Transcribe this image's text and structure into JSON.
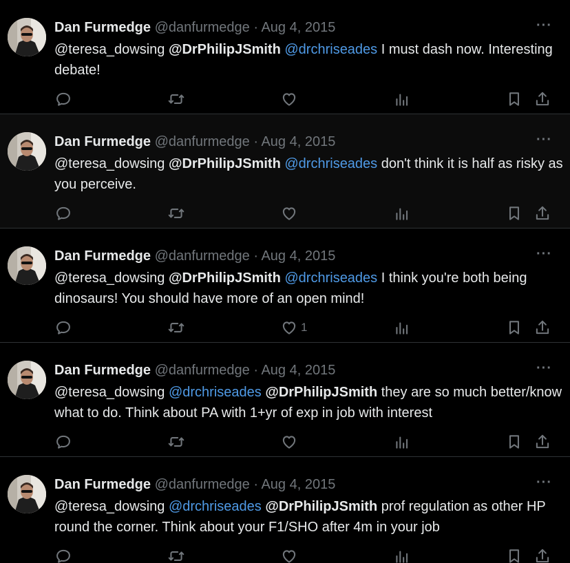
{
  "tweets": [
    {
      "name": "Dan Furmedge",
      "handle": "@danfurmedge",
      "date": "· Aug 4, 2015",
      "more": "···",
      "highlight": false,
      "body": [
        {
          "text": "@teresa_dowsing ",
          "style": "plain"
        },
        {
          "text": "@DrPhilipJSmith",
          "style": "bold"
        },
        {
          "text": " ",
          "style": "plain"
        },
        {
          "text": "@drchriseades",
          "style": "link"
        },
        {
          "text": " I must dash now. Interesting debate!",
          "style": "plain"
        }
      ],
      "likes": ""
    },
    {
      "name": "Dan Furmedge",
      "handle": "@danfurmedge",
      "date": "· Aug 4, 2015",
      "more": "···",
      "highlight": true,
      "body": [
        {
          "text": "@teresa_dowsing ",
          "style": "plain"
        },
        {
          "text": "@DrPhilipJSmith",
          "style": "bold"
        },
        {
          "text": " ",
          "style": "plain"
        },
        {
          "text": "@drchriseades",
          "style": "link"
        },
        {
          "text": " don't think it is half as risky as you perceive.",
          "style": "plain"
        }
      ],
      "likes": ""
    },
    {
      "name": "Dan Furmedge",
      "handle": "@danfurmedge",
      "date": "· Aug 4, 2015",
      "more": "···",
      "highlight": false,
      "body": [
        {
          "text": "@teresa_dowsing ",
          "style": "plain"
        },
        {
          "text": "@DrPhilipJSmith",
          "style": "bold"
        },
        {
          "text": " ",
          "style": "plain"
        },
        {
          "text": "@drchriseades",
          "style": "link"
        },
        {
          "text": " I think you're both being dinosaurs! You should have more of an open mind!",
          "style": "plain"
        }
      ],
      "likes": "1"
    },
    {
      "name": "Dan Furmedge",
      "handle": "@danfurmedge",
      "date": "· Aug 4, 2015",
      "more": "···",
      "highlight": false,
      "body": [
        {
          "text": "@teresa_dowsing ",
          "style": "plain"
        },
        {
          "text": "@drchriseades",
          "style": "link"
        },
        {
          "text": " ",
          "style": "plain"
        },
        {
          "text": "@DrPhilipJSmith",
          "style": "bold"
        },
        {
          "text": " they are so much better/know what to do. Think about PA with 1+yr of exp in job with interest",
          "style": "plain"
        }
      ],
      "likes": ""
    },
    {
      "name": "Dan Furmedge",
      "handle": "@danfurmedge",
      "date": "· Aug 4, 2015",
      "more": "···",
      "highlight": false,
      "body": [
        {
          "text": "@teresa_dowsing ",
          "style": "plain"
        },
        {
          "text": "@drchriseades",
          "style": "link"
        },
        {
          "text": " ",
          "style": "plain"
        },
        {
          "text": "@DrPhilipJSmith",
          "style": "bold"
        },
        {
          "text": " prof regulation as other HP round the corner. Think about your F1/SHO after 4m in your job",
          "style": "plain"
        }
      ],
      "likes": ""
    }
  ],
  "icons": {
    "reply": "reply-icon",
    "retweet": "retweet-icon",
    "like": "like-icon",
    "views": "views-icon",
    "bookmark": "bookmark-icon",
    "share": "share-icon",
    "more": "more-icon"
  },
  "colors": {
    "background": "#000000",
    "text": "#e7e9ea",
    "muted": "#71767b",
    "link": "#4f9ae6",
    "divider": "#2f3336"
  }
}
